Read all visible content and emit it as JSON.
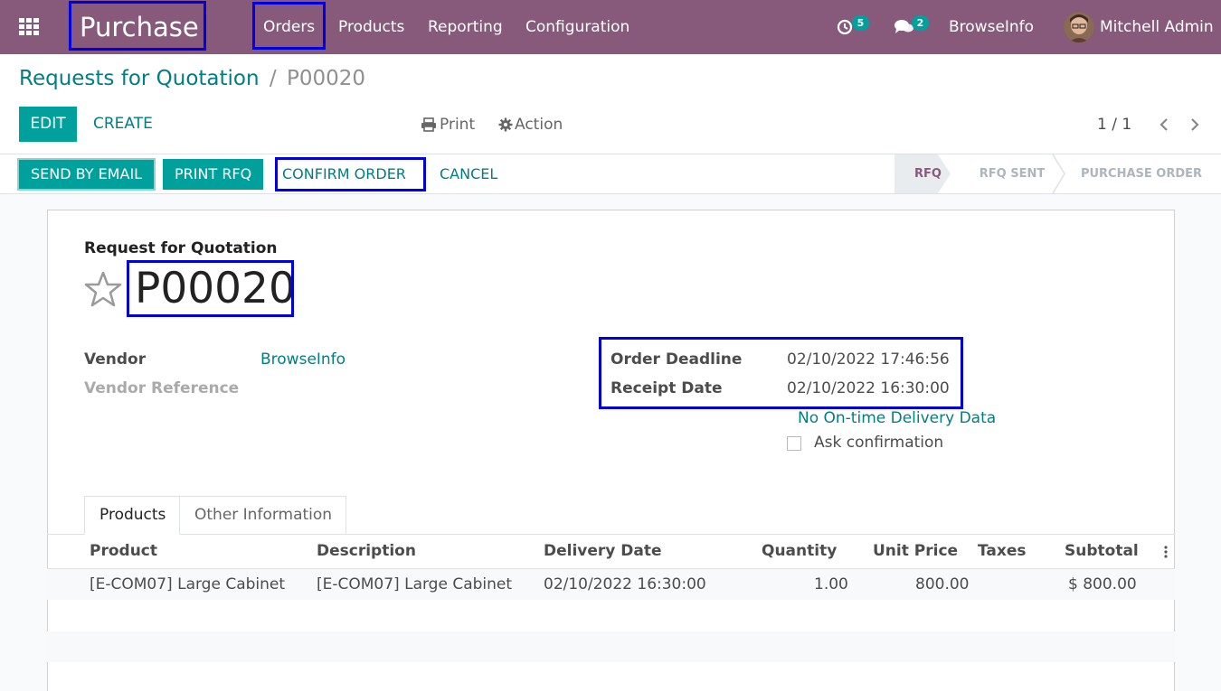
{
  "navbar": {
    "app_name": "Purchase",
    "menu": [
      "Orders",
      "Products",
      "Reporting",
      "Configuration"
    ],
    "activity_count": "5",
    "message_count": "2",
    "company": "BrowseInfo",
    "user": "Mitchell Admin"
  },
  "breadcrumb": {
    "parent": "Requests for Quotation",
    "separator": "/",
    "current": "P00020"
  },
  "control": {
    "edit_label": "EDIT",
    "create_label": "CREATE",
    "print_label": "Print",
    "action_label": "Action",
    "pager": "1 / 1"
  },
  "statusbar": {
    "buttons": [
      "SEND BY EMAIL",
      "PRINT RFQ",
      "CONFIRM ORDER",
      "CANCEL"
    ],
    "stages": [
      "RFQ",
      "RFQ SENT",
      "PURCHASE ORDER"
    ]
  },
  "form": {
    "subtitle": "Request for Quotation",
    "name": "P00020",
    "vendor_label": "Vendor",
    "vendor_value": "BrowseInfo",
    "vendor_ref_label": "Vendor Reference",
    "deadline_label": "Order Deadline",
    "deadline_value": "02/10/2022 17:46:56",
    "receipt_label": "Receipt Date",
    "receipt_value": "02/10/2022 16:30:00",
    "ontime_link": "No On-time Delivery Data",
    "ask_confirmation": "Ask confirmation"
  },
  "tabs": [
    "Products",
    "Other Information"
  ],
  "table": {
    "columns": [
      "Product",
      "Description",
      "Delivery Date",
      "Quantity",
      "Unit Price",
      "Taxes",
      "Subtotal"
    ],
    "rows": [
      [
        "[E-COM07] Large Cabinet",
        "[E-COM07] Large Cabinet",
        "02/10/2022 16:30:00",
        "1.00",
        "800.00",
        "",
        "$ 800.00"
      ]
    ]
  },
  "colors": {
    "brand": "#875a7b",
    "accent": "#00a09d",
    "link": "#017e84",
    "highlight": "#0000e0"
  }
}
